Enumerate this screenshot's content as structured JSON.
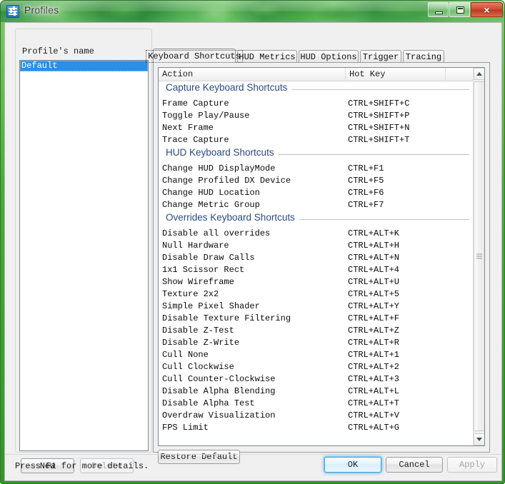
{
  "window": {
    "title": "Profiles",
    "icon": "sliders-icon",
    "controls": {
      "minimize": "minimize-icon",
      "maximize": "maximize-icon",
      "close": "×"
    }
  },
  "left_panel": {
    "group_label": "Profile's name",
    "profiles": [
      {
        "label": "Default",
        "selected": true
      }
    ],
    "buttons": {
      "new": "New",
      "delete": "Delete",
      "delete_disabled": true
    }
  },
  "tabs": [
    {
      "label": "Keyboard Shortcuts",
      "active": true
    },
    {
      "label": "HUD Metrics",
      "active": false
    },
    {
      "label": "HUD Options",
      "active": false
    },
    {
      "label": "Trigger",
      "active": false
    },
    {
      "label": "Tracing",
      "active": false
    }
  ],
  "table": {
    "columns": [
      "Action",
      "Hot Key",
      ""
    ],
    "sections": [
      {
        "title": "Capture Keyboard Shortcuts",
        "rows": [
          {
            "action": "Frame Capture",
            "hotkey": "CTRL+SHIFT+C"
          },
          {
            "action": "Toggle Play/Pause",
            "hotkey": "CTRL+SHIFT+P"
          },
          {
            "action": "Next Frame",
            "hotkey": "CTRL+SHIFT+N"
          },
          {
            "action": "Trace Capture",
            "hotkey": "CTRL+SHIFT+T"
          }
        ]
      },
      {
        "title": "HUD Keyboard Shortcuts",
        "rows": [
          {
            "action": "Change HUD DisplayMode",
            "hotkey": "CTRL+F1"
          },
          {
            "action": "Change Profiled DX Device",
            "hotkey": "CTRL+F5"
          },
          {
            "action": "Change HUD Location",
            "hotkey": "CTRL+F6"
          },
          {
            "action": "Change Metric Group",
            "hotkey": "CTRL+F7"
          }
        ]
      },
      {
        "title": "Overrides Keyboard Shortcuts",
        "rows": [
          {
            "action": "Disable all overrides",
            "hotkey": "CTRL+ALT+K"
          },
          {
            "action": "Null Hardware",
            "hotkey": "CTRL+ALT+H"
          },
          {
            "action": "Disable Draw Calls",
            "hotkey": "CTRL+ALT+N"
          },
          {
            "action": "1x1 Scissor Rect",
            "hotkey": "CTRL+ALT+4"
          },
          {
            "action": "Show Wireframe",
            "hotkey": "CTRL+ALT+U"
          },
          {
            "action": "Texture 2x2",
            "hotkey": "CTRL+ALT+5"
          },
          {
            "action": "Simple Pixel Shader",
            "hotkey": "CTRL+ALT+Y"
          },
          {
            "action": "Disable Texture Filtering",
            "hotkey": "CTRL+ALT+F"
          },
          {
            "action": "Disable Z-Test",
            "hotkey": "CTRL+ALT+Z"
          },
          {
            "action": "Disable Z-Write",
            "hotkey": "CTRL+ALT+R"
          },
          {
            "action": "Cull None",
            "hotkey": "CTRL+ALT+1"
          },
          {
            "action": "Cull Clockwise",
            "hotkey": "CTRL+ALT+2"
          },
          {
            "action": "Cull Counter-Clockwise",
            "hotkey": "CTRL+ALT+3"
          },
          {
            "action": "Disable Alpha Blending",
            "hotkey": "CTRL+ALT+L"
          },
          {
            "action": "Disable Alpha Test",
            "hotkey": "CTRL+ALT+T"
          },
          {
            "action": "Overdraw Visualization",
            "hotkey": "CTRL+ALT+V"
          },
          {
            "action": "FPS Limit",
            "hotkey": "CTRL+ALT+G"
          }
        ]
      }
    ]
  },
  "tab_panel": {
    "restore_default": "Restore Default"
  },
  "footer": {
    "status": "Press F1 for more details.",
    "ok": "OK",
    "cancel": "Cancel",
    "apply": "Apply",
    "apply_disabled": true,
    "ok_focused": true
  },
  "colors": {
    "frame_green": "#4aa83c",
    "selection_blue": "#2a8fe8",
    "section_heading": "#2a4a82",
    "close_red": "#cf4a30"
  }
}
